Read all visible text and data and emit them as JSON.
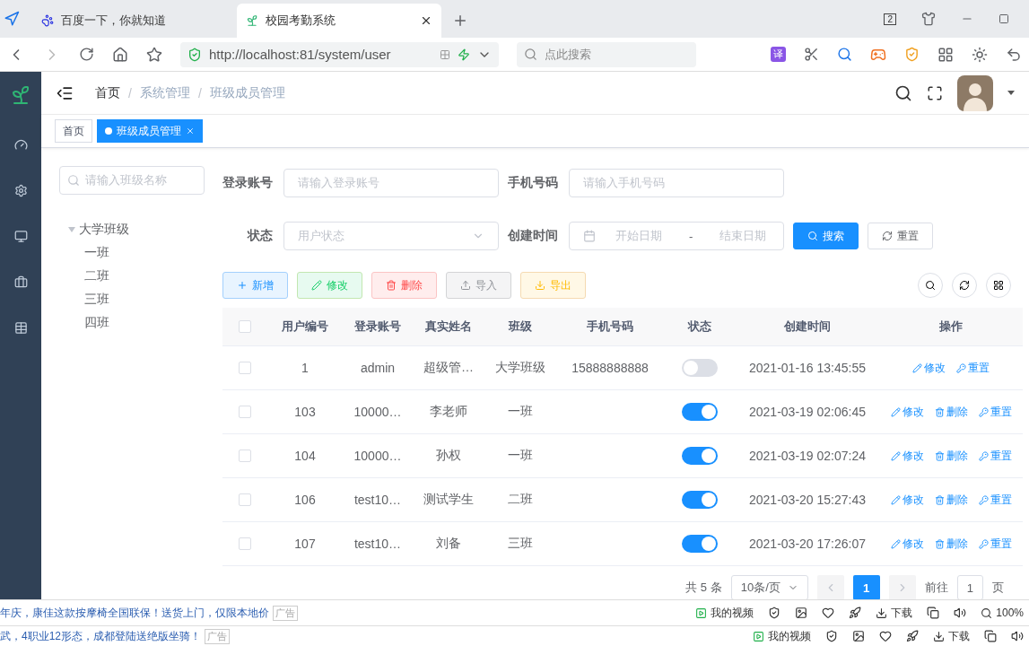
{
  "browser": {
    "tabs": [
      {
        "title": "百度一下，你就知道",
        "kind": "baidu",
        "selected": false
      },
      {
        "title": "校园考勤系统",
        "kind": "app",
        "selected": true
      }
    ],
    "tab_count": "2",
    "address": "http://localhost:81/system/user",
    "search_placeholder": "点此搜索",
    "translate": "译"
  },
  "header": {
    "breadcrumb": [
      "首页",
      "系统管理",
      "班级成员管理"
    ],
    "separator": "/"
  },
  "tags": [
    {
      "label": "首页",
      "selected": false
    },
    {
      "label": "班级成员管理",
      "selected": true
    }
  ],
  "tree": {
    "search_placeholder": "请输入班级名称",
    "nodes": [
      {
        "label": "大学班级",
        "expanded": true,
        "children": [
          {
            "label": "一班"
          },
          {
            "label": "二班"
          },
          {
            "label": "三班"
          },
          {
            "label": "四班"
          }
        ]
      }
    ]
  },
  "filters": [
    {
      "kind": "input",
      "label": "登录账号",
      "placeholder": "请输入登录账号"
    },
    {
      "kind": "input",
      "label": "手机号码",
      "placeholder": "请输入手机号码"
    },
    {
      "kind": "select",
      "label": "状态",
      "placeholder": "用户状态"
    },
    {
      "kind": "daterange",
      "label": "创建时间",
      "start_placeholder": "开始日期",
      "separator": "-",
      "end_placeholder": "结束日期"
    }
  ],
  "search_button": "搜索",
  "reset_button": "重置",
  "toolbar": [
    {
      "kind": "primary",
      "label": "新增"
    },
    {
      "kind": "success",
      "label": "修改"
    },
    {
      "kind": "danger",
      "label": "删除"
    },
    {
      "kind": "info",
      "label": "导入"
    },
    {
      "kind": "warning",
      "label": "导出"
    }
  ],
  "table": {
    "columns": [
      "用户编号",
      "登录账号",
      "真实姓名",
      "班级",
      "手机号码",
      "状态",
      "创建时间",
      "操作"
    ],
    "select_all_checked": false,
    "rows": [
      {
        "checked": false,
        "id": "1",
        "account": "admin",
        "name": "超级管…",
        "class": "大学班级",
        "phone": "15888888888",
        "on": false,
        "created": "2021-01-16 13:45:55",
        "actions": [
          {
            "kind": "edit",
            "label": "修改"
          },
          {
            "kind": "reset",
            "label": "重置"
          }
        ]
      },
      {
        "checked": false,
        "id": "103",
        "account": "10000…",
        "name": "李老师",
        "class": "一班",
        "on": true,
        "created": "2021-03-19 02:06:45",
        "actions": [
          {
            "kind": "edit",
            "label": "修改"
          },
          {
            "kind": "delete",
            "label": "删除"
          },
          {
            "kind": "reset",
            "label": "重置"
          }
        ]
      },
      {
        "checked": false,
        "id": "104",
        "account": "10000…",
        "name": "孙权",
        "class": "一班",
        "on": true,
        "created": "2021-03-19 02:07:24",
        "actions": [
          {
            "kind": "edit",
            "label": "修改"
          },
          {
            "kind": "delete",
            "label": "删除"
          },
          {
            "kind": "reset",
            "label": "重置"
          }
        ]
      },
      {
        "checked": false,
        "id": "106",
        "account": "test10…",
        "name": "测试学生",
        "class": "二班",
        "on": true,
        "created": "2021-03-20 15:27:43",
        "actions": [
          {
            "kind": "edit",
            "label": "修改"
          },
          {
            "kind": "delete",
            "label": "删除"
          },
          {
            "kind": "reset",
            "label": "重置"
          }
        ]
      },
      {
        "checked": false,
        "id": "107",
        "account": "test10…",
        "name": "刘备",
        "class": "三班",
        "on": true,
        "created": "2021-03-20 17:26:07",
        "actions": [
          {
            "kind": "edit",
            "label": "修改"
          },
          {
            "kind": "delete",
            "label": "删除"
          },
          {
            "kind": "reset",
            "label": "重置"
          }
        ]
      }
    ]
  },
  "pagination": {
    "total": "共 5 条",
    "page_size": "10条/页",
    "pages": [
      {
        "label": "1",
        "selected": true
      }
    ],
    "goto": "前往",
    "goto_value": "1",
    "suffix": "页"
  },
  "status_bars": [
    {
      "news": "年庆，康佳这款按摩椅全国联保！送货上门，仅限本地价",
      "ad": "广告",
      "video": "我的视频",
      "download": "下载",
      "zoom": "100%"
    },
    {
      "news": "武，4职业12形态，成都登陆送绝版坐骑！",
      "ad": "广告",
      "video": "我的视频",
      "download": "下载"
    }
  ]
}
